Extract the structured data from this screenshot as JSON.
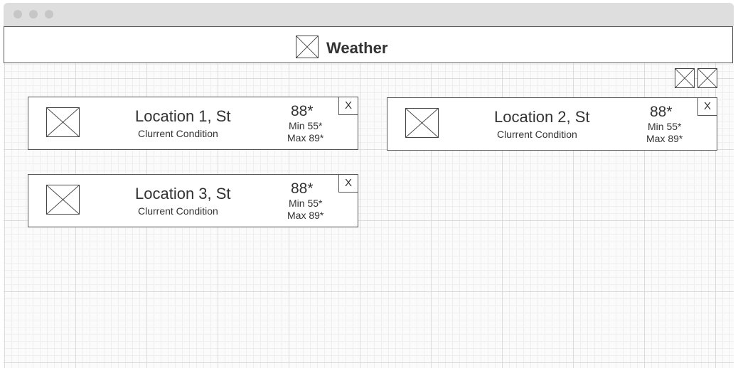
{
  "header": {
    "title": "Weather",
    "icon": "image-placeholder-icon"
  },
  "locations": [
    {
      "name": "Location 1, St",
      "condition": "Clurrent Condition",
      "temp": "88*",
      "min": "Min 55*",
      "max": "Max 89*",
      "close": "X"
    },
    {
      "name": "Location 2, St",
      "condition": "Clurrent Condition",
      "temp": "88*",
      "min": "Min 55*",
      "max": "Max 89*",
      "close": "X"
    },
    {
      "name": "Location 3, St",
      "condition": "Clurrent Condition",
      "temp": "88*",
      "min": "Min 55*",
      "max": "Max 89*",
      "close": "X"
    }
  ],
  "toolbar_icons": [
    "image-placeholder-icon",
    "image-placeholder-icon"
  ],
  "colors": {
    "border": "#555555",
    "grid": "#dcdcdc",
    "titlebar": "#dedede"
  }
}
